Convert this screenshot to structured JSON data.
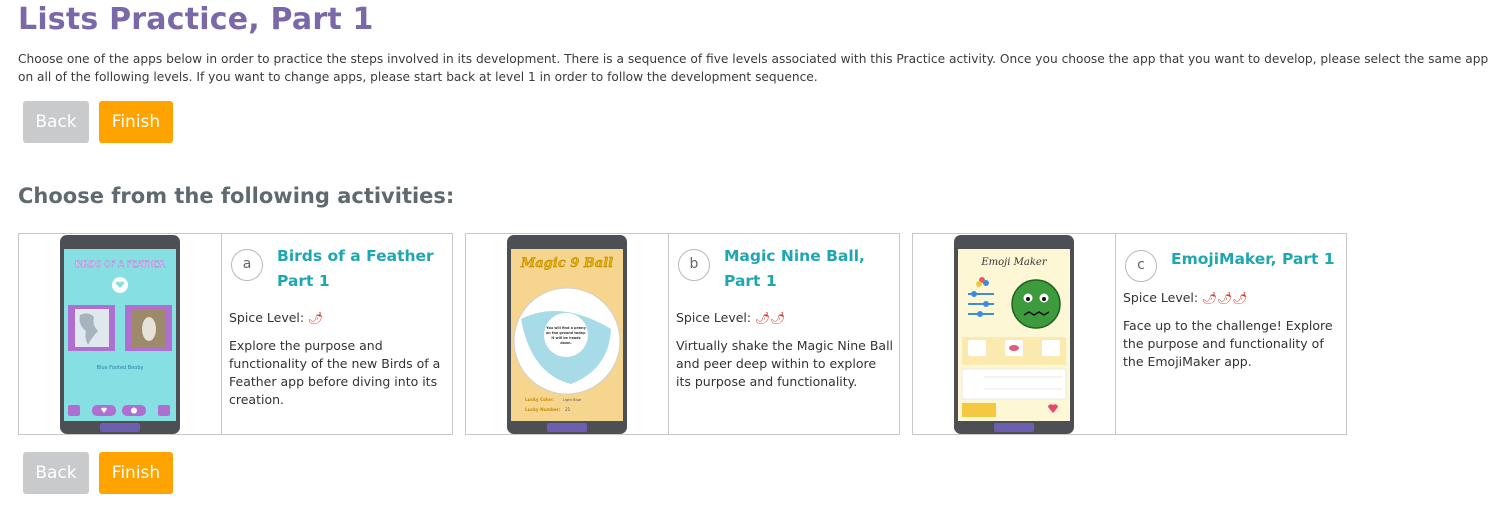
{
  "page": {
    "title": "Lists Practice, Part 1",
    "intro": "Choose one of the apps below in order to practice the steps involved in its development. There is a sequence of five levels associated with this Practice activity. Once you choose the app that you want to develop, please select the same app on all of the following levels. If you want to change apps, please start back at level 1 in order to follow the development sequence.",
    "section_heading": "Choose from the following activities:"
  },
  "nav": {
    "back_label": "Back",
    "finish_label": "Finish"
  },
  "colors": {
    "title": "#7b68a8",
    "accent_teal": "#1ea7b2",
    "finish": "#ffa300",
    "back": "#c8cacc"
  },
  "activities": [
    {
      "letter": "a",
      "title": "Birds of a Feather Part 1",
      "spice_label": "Spice Level:",
      "spice_level": 1,
      "spice_icons": "🌶",
      "description": "Explore the purpose and functionality of the new Birds of a Feather app before diving into its creation.",
      "thumb_title": "BIRDS OF A FEATHER",
      "thumb_caption": "Blue Footed Booby"
    },
    {
      "letter": "b",
      "title": "Magic Nine Ball, Part 1",
      "spice_label": "Spice Level:",
      "spice_level": 2,
      "spice_icons": "🌶🌶",
      "description": "Virtually shake the Magic Nine Ball and peer deep within to explore its purpose and functionality.",
      "thumb_title": "Magic 9 Ball",
      "thumb_message": "You will find a penny on the ground today. It will be heads down.",
      "thumb_color_label": "Lucky Color:",
      "thumb_color_value": "Light Blue",
      "thumb_number_label": "Lucky Number:",
      "thumb_number_value": "21"
    },
    {
      "letter": "c",
      "title": "EmojiMaker, Part 1",
      "spice_label": "Spice Level:",
      "spice_level": 3,
      "spice_icons": "🌶🌶🌶",
      "description": "Face up to the challenge! Explore the purpose and functionality of the EmojiMaker app.",
      "thumb_title": "Emoji Maker"
    }
  ]
}
